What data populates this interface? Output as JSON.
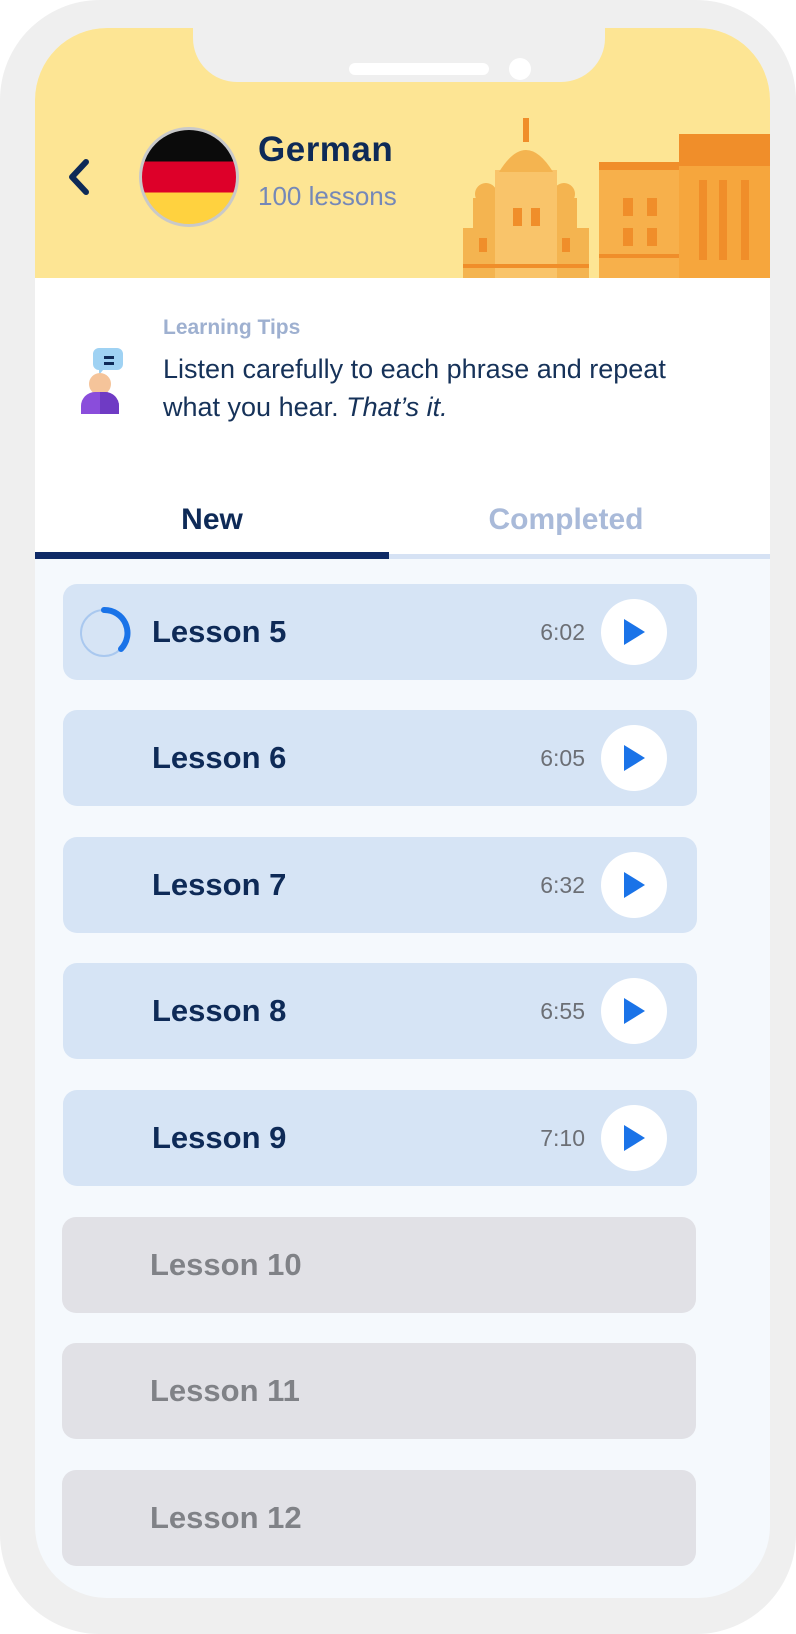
{
  "header": {
    "back_label": "‹",
    "language": "German",
    "lesson_count": "100 lessons",
    "flag_colors": [
      "#000000",
      "#dd0029",
      "#ffd23f"
    ],
    "background_color": "#fde594"
  },
  "tips": {
    "label": "Learning Tips",
    "text": "Listen carefully to each phrase and repeat what you hear.",
    "emphasis": "That’s it."
  },
  "tabs": [
    {
      "label": "New",
      "active": true
    },
    {
      "label": "Completed",
      "active": false
    }
  ],
  "lessons": [
    {
      "name": "Lesson 5",
      "duration": "6:02",
      "status": "in-progress",
      "progress": 0.3
    },
    {
      "name": "Lesson 6",
      "duration": "6:05",
      "status": "available"
    },
    {
      "name": "Lesson 7",
      "duration": "6:32",
      "status": "available"
    },
    {
      "name": "Lesson 8",
      "duration": "6:55",
      "status": "available"
    },
    {
      "name": "Lesson 9",
      "duration": "7:10",
      "status": "available"
    },
    {
      "name": "Lesson 10",
      "status": "locked"
    },
    {
      "name": "Lesson 11",
      "status": "locked"
    },
    {
      "name": "Lesson 12",
      "status": "locked"
    }
  ],
  "colors": {
    "accent": "#1a73e8",
    "navy": "#0e2a57",
    "card_available": "#d6e4f5",
    "card_locked": "#e1e1e6"
  },
  "icons": {
    "back": "chevron-left-icon",
    "play": "play-icon",
    "tips": "person-speech-icon"
  }
}
